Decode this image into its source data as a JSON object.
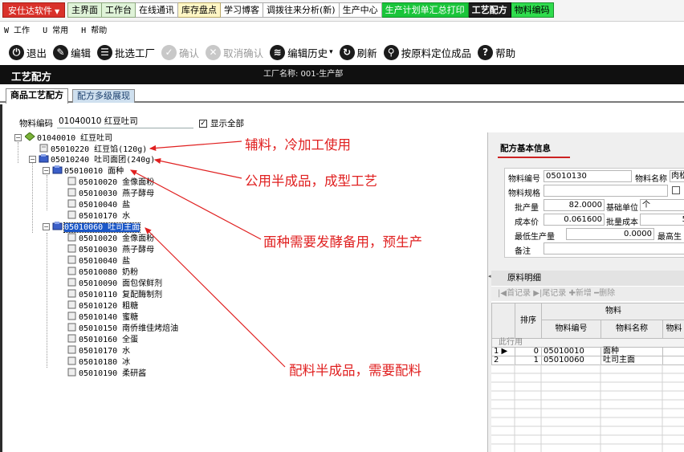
{
  "tabbar": {
    "brand": "安仕达软件",
    "tabs": [
      "主界面",
      "工作台",
      "在线通讯",
      "库存盘点",
      "学习博客",
      "调拨往来分析(新)",
      "生产中心",
      "生产计划单汇总打印",
      "工艺配方",
      "物料编码"
    ]
  },
  "menu": [
    "W 工作",
    "U 常用",
    "H 帮助"
  ],
  "toolbar": {
    "exit": "退出",
    "edit": "编辑",
    "pick_factory": "批选工厂",
    "confirm": "确认",
    "cancel_confirm": "取消确认",
    "edit_history": "编辑历史",
    "refresh": "刷新",
    "locate": "按原料定位成品",
    "help": "帮助"
  },
  "header": {
    "title": "工艺配方",
    "factory": "工厂名称: 001-生产部"
  },
  "subtabs": [
    "商品工艺配方",
    "配方多级展现"
  ],
  "filter": {
    "label": "物料编码",
    "value": "01040010 红豆吐司",
    "show_all": "显示全部"
  },
  "tree": {
    "root": "01040010 红豆吐司",
    "n1": "05010220 红豆馅(120g)",
    "n2": "05010240 吐司面团(240g)",
    "n2a": "05010010 面种",
    "n2a_children": [
      "05010020 金像面粉",
      "05010030 燕子酵母",
      "05010040 盐",
      "05010170 水"
    ],
    "n2b": "05010060 吐司主面",
    "n2b_children": [
      "05010020 金像面粉",
      "05010030 燕子酵母",
      "05010040 盐",
      "05010080 奶粉",
      "05010090 面包保鲜剂",
      "05010110 复配酶制剂",
      "05010120 粗糖",
      "05010140 蜜糖",
      "05010150 南侨维佳烤焙油",
      "05010160 全蛋",
      "05010170 水",
      "05010180 冰",
      "05010190 柔研酱"
    ]
  },
  "annotations": {
    "a1": "辅料，冷加工使用",
    "a2": "公用半成品，成型工艺",
    "a3": "面种需要发酵备用，预生产",
    "a4": "配料半成品，需要配料"
  },
  "basic_info": {
    "title": "配方基本信息",
    "code_label": "物料编号",
    "code_value": "05010130",
    "name_label": "物料名称",
    "name_value": "肉松",
    "spec_label": "物料规格",
    "batch_label": "批产量",
    "batch_value": "82.0000",
    "unit_label": "基础单位",
    "unit_value": "个",
    "cost_label": "成本价",
    "cost_value": "0.061600",
    "batch_cost_label": "批量成本",
    "batch_cost_value": "5",
    "min_label": "最低生产量",
    "min_value": "0.0000",
    "max_label": "最高生",
    "note_label": "备注"
  },
  "detail": {
    "title": "原料明细",
    "tools": [
      "首记录",
      "尾记录",
      "新增",
      "删除"
    ],
    "col_group": "物料",
    "cols": [
      "排序",
      "物料编号",
      "物料名称",
      "物料"
    ],
    "group_label": "此行用",
    "rows": [
      {
        "idx": "1",
        "sort": "0",
        "code": "05010010",
        "name": "面种"
      },
      {
        "idx": "2",
        "sort": "1",
        "code": "05010060",
        "name": "吐司主面"
      }
    ]
  }
}
